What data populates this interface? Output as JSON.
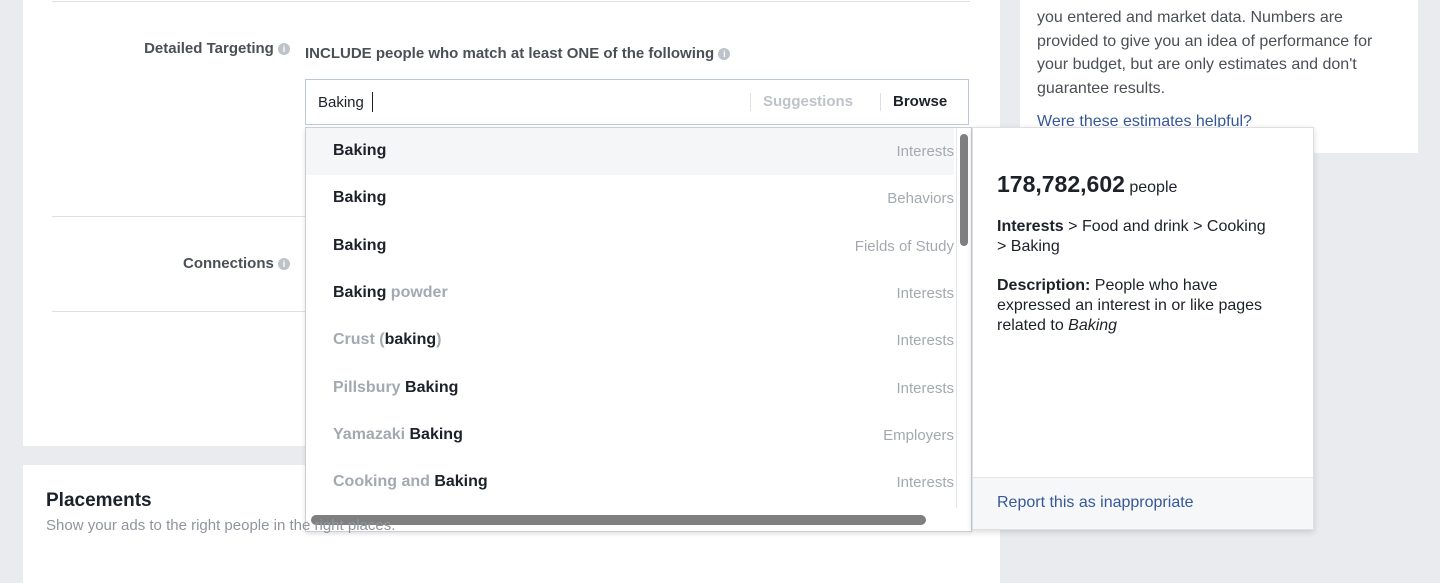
{
  "targeting": {
    "detailed_label": "Detailed Targeting",
    "include_heading": "INCLUDE people who match at least ONE of the following",
    "input_value": "Baking",
    "suggestions_tab": "Suggestions",
    "browse_tab": "Browse",
    "connections_label": "Connections"
  },
  "dropdown": {
    "items": [
      {
        "prefix": "",
        "match": "Baking",
        "suffix": "",
        "category": "Interests",
        "highlighted": true
      },
      {
        "prefix": "",
        "match": "Baking",
        "suffix": "",
        "category": "Behaviors"
      },
      {
        "prefix": "",
        "match": "Baking",
        "suffix": "",
        "category": "Fields of Study"
      },
      {
        "prefix": "",
        "match": "Baking",
        "suffix": " powder",
        "category": "Interests"
      },
      {
        "prefix": "Crust (",
        "match": "baking",
        "suffix": ")",
        "category": "Interests"
      },
      {
        "prefix": "Pillsbury ",
        "match": "Baking",
        "suffix": "",
        "category": "Interests"
      },
      {
        "prefix": "Yamazaki ",
        "match": "Baking",
        "suffix": "",
        "category": "Employers"
      },
      {
        "prefix": "Cooking and ",
        "match": "Baking",
        "suffix": "",
        "category": "Interests"
      }
    ]
  },
  "detail": {
    "count": "178,782,602",
    "count_unit": "people",
    "path_label": "Interests",
    "path_rest": " > Food and drink > Cooking > Baking",
    "description_label": "Description:",
    "description_text": " People who have expressed an interest in or like pages related to ",
    "description_topic": "Baking",
    "report_link": "Report this as inappropriate"
  },
  "side": {
    "text": "you entered and market data. Numbers are provided to give you an idea of performance for your budget, but are only estimates and don't guarantee results.",
    "link": "Were these estimates helpful?"
  },
  "placements": {
    "title": "Placements",
    "subtitle": "Show your ads to the right people in the right places."
  },
  "colors": {
    "link": "#365899",
    "muted": "#a4a9b1",
    "page_bg": "#e9ebee"
  }
}
